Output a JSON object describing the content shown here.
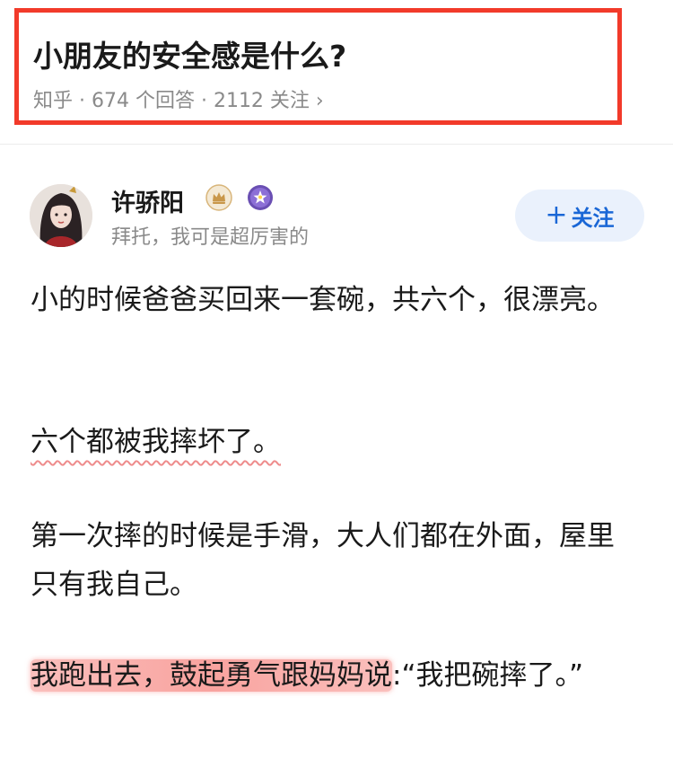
{
  "question": {
    "title": "小朋友的安全感是什么?",
    "meta": "知乎 · 674 个回答 · 2112 关注 ›"
  },
  "author": {
    "name": "许骄阳",
    "bio": "拜托，我可是超厉害的",
    "badges": [
      "crown-badge-icon",
      "star-badge-icon"
    ]
  },
  "follow": {
    "plus": "+",
    "label": "关注"
  },
  "answer": {
    "p1": "小的时候爸爸买回来一套碗，共六个，很漂亮。",
    "p2": "六个都被我摔坏了。",
    "p3": "第一次摔的时候是手滑，大人们都在外面，屋里只有我自己。",
    "p4_highlight": "我跑出去，鼓起勇气跟妈妈说",
    "p4_rest": ":“我把碗摔了。”"
  },
  "colors": {
    "box_border": "#f23a2a",
    "follow_bg": "#eaf1fc",
    "follow_text": "#1a67d6",
    "highlight": "#f78c87"
  }
}
